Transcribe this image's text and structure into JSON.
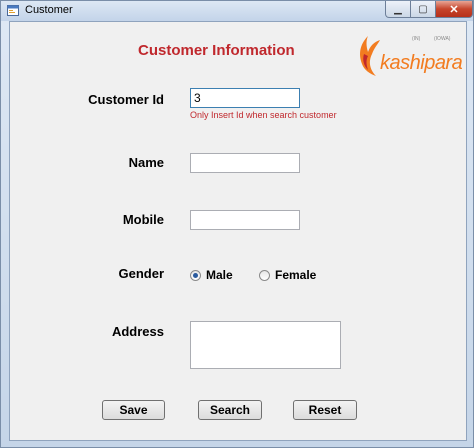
{
  "window": {
    "title": "Customer"
  },
  "form": {
    "heading": "Customer Information",
    "logo_text": "kashipara",
    "logo_small_left": "(IN)",
    "logo_small_right": "(IOWA)",
    "customer_id_label": "Customer Id",
    "customer_id_value": "3",
    "customer_id_hint": "Only Insert Id when search customer",
    "name_label": "Name",
    "name_value": "",
    "mobile_label": "Mobile",
    "mobile_value": "",
    "gender_label": "Gender",
    "gender_options": [
      "Male",
      "Female"
    ],
    "gender_selected": "Male",
    "address_label": "Address",
    "address_value": ""
  },
  "buttons": {
    "save": "Save",
    "search": "Search",
    "reset": "Reset"
  },
  "colors": {
    "heading": "#c0282d",
    "hint": "#c0282d",
    "logo": "#f27c20"
  }
}
